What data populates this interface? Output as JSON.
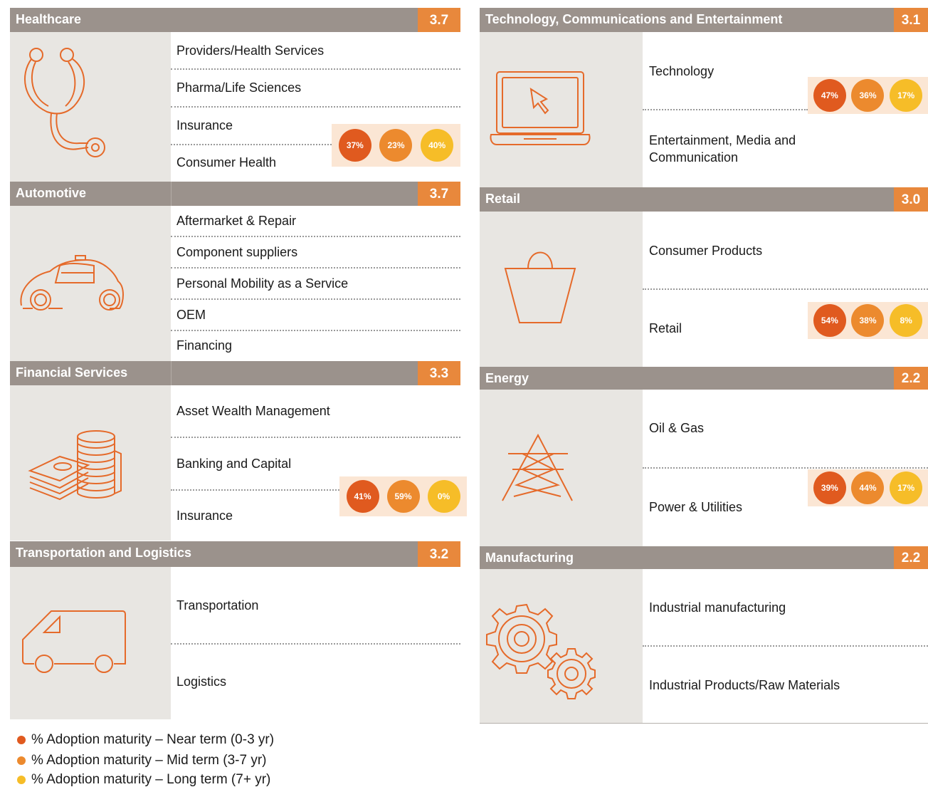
{
  "colors": {
    "header": "#9b928c",
    "score": "#e8883c",
    "near": "#e05a1f",
    "mid": "#ec8a2e",
    "long": "#f6bd28",
    "icon_stroke": "#e56a2a",
    "icon_bg": "#e8e6e2"
  },
  "healthcare": {
    "title": "Healthcare",
    "score": "3.7",
    "icon": "stethoscope-icon",
    "items": [
      "Providers/Health Services",
      "Pharma/Life Sciences",
      "Insurance",
      "Consumer Health"
    ],
    "adoption": [
      "37%",
      "23%",
      "40%"
    ]
  },
  "automotive": {
    "title": "Automotive",
    "score": "3.7",
    "icon": "car-icon",
    "items": [
      "Aftermarket & Repair",
      "Component suppliers",
      "Personal Mobility as a Service",
      "OEM",
      "Financing"
    ]
  },
  "financial": {
    "title": "Financial Services",
    "score": "3.3",
    "icon": "coins-icon",
    "items": [
      "Asset Wealth Management",
      "Banking and Capital",
      "Insurance"
    ],
    "adoption": [
      "41%",
      "59%",
      "0%"
    ]
  },
  "transportation": {
    "title": "Transportation and Logistics",
    "score": "3.2",
    "icon": "van-icon",
    "items": [
      "Transportation",
      "Logistics"
    ]
  },
  "technology": {
    "title": "Technology, Communications and Entertainment",
    "score": "3.1",
    "icon": "laptop-icon",
    "items": [
      "Technology",
      "Entertainment, Media and",
      "Communication"
    ],
    "adoption": [
      "47%",
      "36%",
      "17%"
    ]
  },
  "retail": {
    "title": "Retail",
    "score": "3.0",
    "icon": "shopping-bag-icon",
    "items": [
      "Consumer Products",
      "Retail"
    ],
    "adoption": [
      "54%",
      "38%",
      "8%"
    ]
  },
  "energy": {
    "title": "Energy",
    "score": "2.2",
    "icon": "pylon-icon",
    "items": [
      "Oil & Gas",
      "Power & Utilities"
    ],
    "adoption": [
      "39%",
      "44%",
      "17%"
    ]
  },
  "manufacturing": {
    "title": "Manufacturing",
    "score": "2.2",
    "icon": "gears-icon",
    "items": [
      "Industrial manufacturing",
      "Industrial Products/Raw Materials"
    ]
  },
  "legend": [
    "% Adoption maturity – Near term (0-3 yr)",
    "% Adoption maturity – Mid term (3-7 yr)",
    "% Adoption maturity – Long term (7+ yr)"
  ]
}
